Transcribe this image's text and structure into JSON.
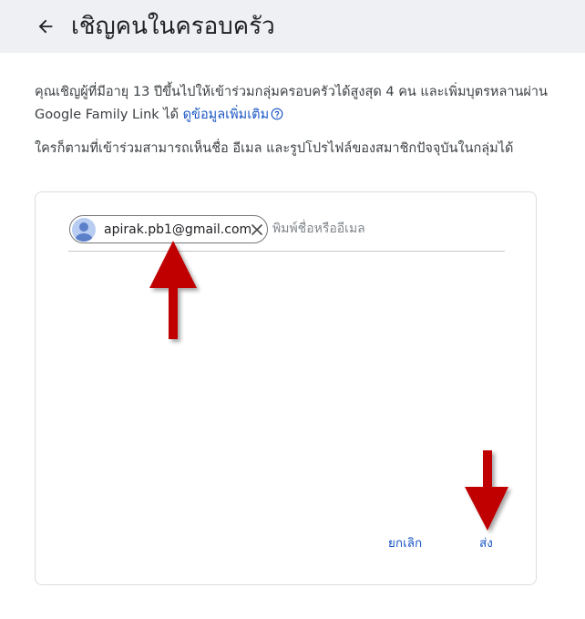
{
  "header": {
    "title": "เชิญคนในครอบครัว",
    "back_icon": "arrow-back-icon"
  },
  "description": {
    "line1_text": "คุณเชิญผู้ที่มีอายุ 13 ปีขึ้นไปให้เข้าร่วมกลุ่มครอบครัวได้สูงสุด 4 คน และเพิ่มบุตรหลานผ่าน Google Family Link ได้",
    "learn_more_label": "ดูข้อมูลเพิ่มเติม",
    "help_icon": "help-circle-icon",
    "line2_text": "ใครก็ตามที่เข้าร่วมสามารถเห็นชื่อ อีเมล และรูปโปรไฟล์ของสมาชิกปัจจุบันในกลุ่มได้"
  },
  "invite_form": {
    "recipient_chip": {
      "email": "apirak.pb1@gmail.com",
      "avatar_icon": "person-avatar-icon",
      "remove_icon": "close-icon"
    },
    "input_placeholder": "พิมพ์ชื่อหรืออีเมล",
    "input_value": "",
    "cancel_label": "ยกเลิก",
    "send_label": "ส่ง"
  },
  "colors": {
    "header_bg": "#eef0f3",
    "link": "#1a56c4",
    "annotation_arrow": "#c00000"
  }
}
